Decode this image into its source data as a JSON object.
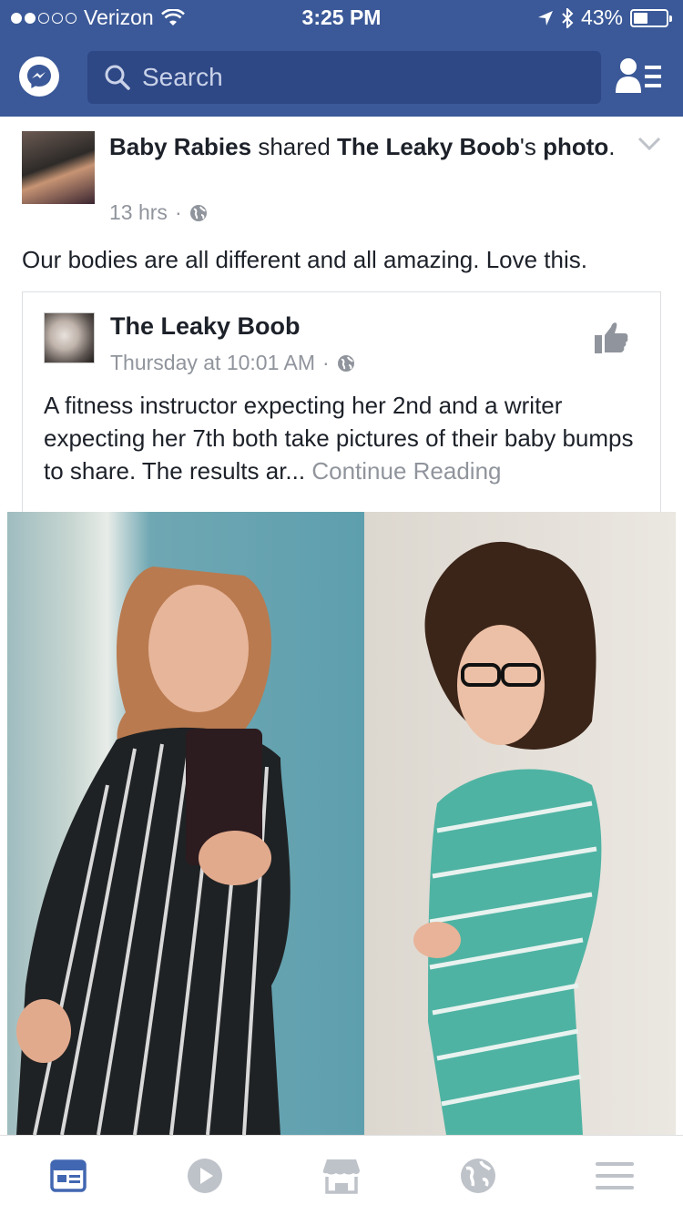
{
  "status_bar": {
    "carrier": "Verizon",
    "time": "3:25 PM",
    "battery": "43%",
    "battery_level": 0.43,
    "signal_bars": 2
  },
  "search": {
    "placeholder": "Search"
  },
  "post": {
    "author": "Baby Rabies",
    "verb": "shared",
    "source": "The Leaky Boob",
    "suffix": "'s",
    "object": "photo",
    "period": ".",
    "time": "13 hrs",
    "separator": "·",
    "text": "Our bodies are all different and all amazing. Love this."
  },
  "shared_post": {
    "page_name": "The Leaky Boob",
    "time": "Thursday at 10:01 AM",
    "separator": "·",
    "text": "A fitness instructor expecting her 2nd and a writer expecting her 7th both take pictures of their baby bumps to share. The results ar...",
    "continue": "Continue Reading"
  },
  "tabs": [
    {
      "icon": "news-feed-icon",
      "active": true
    },
    {
      "icon": "video-icon",
      "active": false
    },
    {
      "icon": "marketplace-icon",
      "active": false
    },
    {
      "icon": "notifications-globe-icon",
      "active": false
    },
    {
      "icon": "menu-icon",
      "active": false
    }
  ],
  "colors": {
    "brand": "#3b5998",
    "search_bg": "#2e4785",
    "secondary_text": "#90949c",
    "active_tab": "#4267b2",
    "inactive_tab": "#bec2c9"
  }
}
